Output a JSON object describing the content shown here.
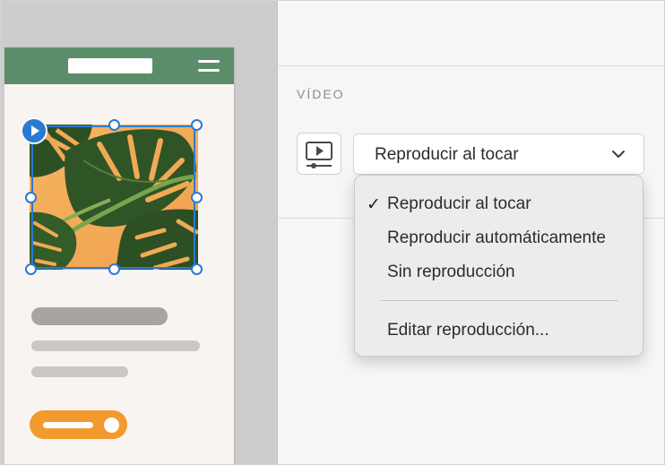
{
  "inspector": {
    "section_title": "VÍDEO",
    "video_icon": "video-playback-icon",
    "select": {
      "value": "Reproducir al tocar",
      "chevron_icon": "chevron-down-icon"
    }
  },
  "menu": {
    "items": [
      {
        "label": "Reproducir al tocar",
        "checked": true,
        "check_glyph": "✓"
      },
      {
        "label": "Reproducir automáticamente",
        "checked": false
      },
      {
        "label": "Sin reproducción",
        "checked": false
      }
    ],
    "footer_item": {
      "label": "Editar reproducción..."
    }
  },
  "canvas": {
    "phone_header_color": "#5b8d6b",
    "selection_color": "#2a7ad3",
    "cta_color": "#f29a2e",
    "image_subject": "monstera-leaves-on-orange"
  }
}
